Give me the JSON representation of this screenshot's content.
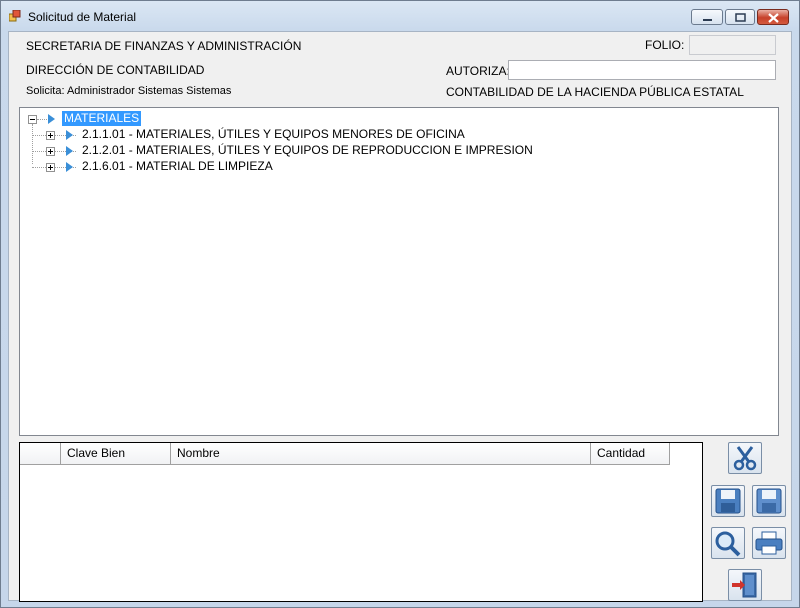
{
  "window": {
    "title": "Solicitud de Material",
    "icons": {
      "app": "app-window-icon",
      "minimize": "minimize-icon",
      "maximize": "maximize-icon",
      "close": "close-icon"
    }
  },
  "header": {
    "secretaria": "SECRETARIA DE FINANZAS Y ADMINISTRACIÓN",
    "direccion": "DIRECCIÓN DE CONTABILIDAD",
    "solicita": "Solicita: Administrador Sistemas Sistemas",
    "folio_label": "FOLIO:",
    "folio_value": "",
    "autoriza_label": "AUTORIZA:",
    "autoriza_value": "",
    "contabilidad": "CONTABILIDAD DE LA HACIENDA PÚBLICA ESTATAL"
  },
  "tree": {
    "root": {
      "label": "MATERIALES",
      "expanded": true,
      "selected": true
    },
    "children": [
      {
        "label": "2.1.1.01 - MATERIALES, ÚTILES Y EQUIPOS MENORES DE OFICINA",
        "expanded": false
      },
      {
        "label": "2.1.2.01 - MATERIALES, ÚTILES Y EQUIPOS DE REPRODUCCION E IMPRESION",
        "expanded": false
      },
      {
        "label": "2.1.6.01 - MATERIAL DE LIMPIEZA",
        "expanded": false
      }
    ]
  },
  "grid": {
    "columns": [
      "",
      "Clave Bien",
      "Nombre",
      "Cantidad"
    ],
    "rows": []
  },
  "toolbar": {
    "buttons": [
      {
        "name": "cut-button",
        "icon": "scissors-icon"
      },
      {
        "name": "save-button",
        "icon": "floppy-disk-icon"
      },
      {
        "name": "save-disabled-button",
        "icon": "floppy-disk-icon"
      },
      {
        "name": "search-button",
        "icon": "magnifier-icon"
      },
      {
        "name": "print-button",
        "icon": "printer-icon"
      },
      {
        "name": "exit-button",
        "icon": "exit-door-icon"
      }
    ]
  },
  "colors": {
    "selection": "#3399ff",
    "tree_arrow": "#3a8fd8",
    "close_button": "#c7412a",
    "window_frame": "#c6d6ea"
  }
}
